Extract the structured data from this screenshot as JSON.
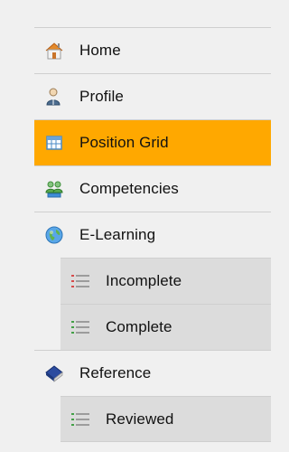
{
  "nav": {
    "home": "Home",
    "profile": "Profile",
    "position_grid": "Position Grid",
    "competencies": "Competencies",
    "elearning": "E-Learning",
    "incomplete": "Incomplete",
    "complete": "Complete",
    "reference": "Reference",
    "reviewed": "Reviewed"
  },
  "colors": {
    "active": "#ffa800",
    "background": "#f0f0f0",
    "sub_background": "#dcdcdc"
  },
  "icons": {
    "home": "house-icon",
    "profile": "user-icon",
    "position_grid": "grid-icon",
    "competencies": "people-icon",
    "elearning": "globe-icon",
    "incomplete": "list-icon",
    "complete": "list-icon",
    "reference": "book-icon",
    "reviewed": "list-icon"
  }
}
